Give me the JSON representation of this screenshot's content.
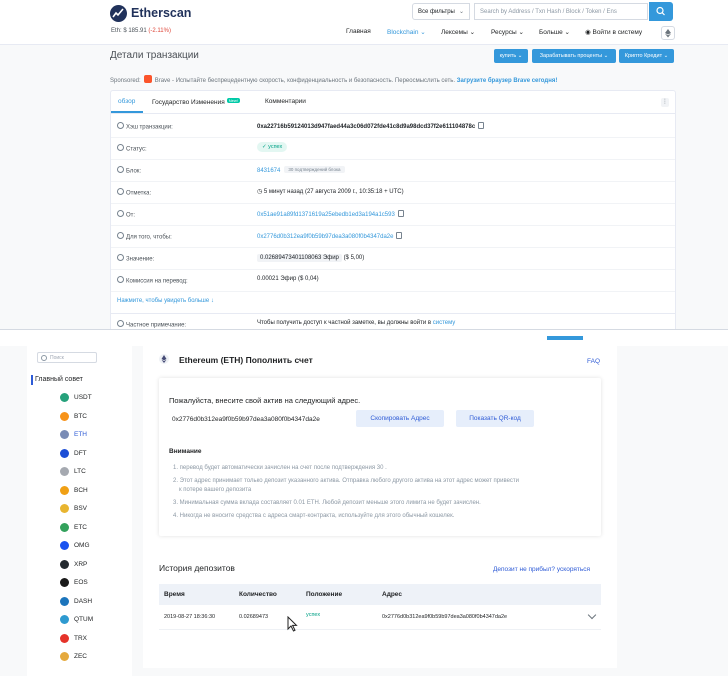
{
  "top": {
    "brand": "Etherscan",
    "price_label": "Eth: $ 185.91",
    "price_change": "(-2.11%)",
    "filter": "Все фильтры",
    "search_placeholder": "Search by Address / Txn Hash / Block / Token / Ens",
    "nav": [
      "Главная",
      "Blockchain",
      "Лексемы",
      "Ресурсы",
      "Больше",
      "Войти в систему"
    ],
    "page_title": "Детали транзакции",
    "buttons": [
      "купить",
      "Зарабатывать проценты",
      "Крипто Кредит"
    ],
    "sponsored_label": "Sponsored:",
    "sponsored_text": "Brave - Испытайте беспрецедентную скорость, конфиденциальность и безопасность. Переосмыслить сеть.",
    "sponsored_link": "Загрузите браузер Brave сегодня!",
    "tabs": [
      "обзор",
      "Государство Изменения",
      "Комментарии"
    ],
    "new_badge": "New!",
    "rows": [
      {
        "label": "Хэш транзакции:",
        "value": "0xa22716b59124013d947faed44a3c06d072fde41c8d9a98dcd37f2e611104878c"
      },
      {
        "label": "Статус:",
        "value": "успех"
      },
      {
        "label": "Блок:",
        "value": "8431674",
        "extra": "30 подтверждений блока"
      },
      {
        "label": "Отметка:",
        "value": "5 минут назад (27 августа 2009 г., 10:35:18 + UTC)"
      },
      {
        "label": "От:",
        "value": "0x51ae91a89fd1371619a25ebedb1ed3a194a1c593"
      },
      {
        "label": "Для того, чтобы:",
        "value": "0x2776d0b312ea9f0b59b97dea3a080f0b4347da2e"
      },
      {
        "label": "Значение:",
        "value": "0.02689473401108063 Эфир",
        "extra": "($ 5,00)"
      },
      {
        "label": "Комиссия на перевод:",
        "value": "0.00021 Эфир ($ 0,04)"
      },
      {
        "label": "Частное примечание:",
        "value": "Чтобы получить доступ к частной заметке, вы должны войти в",
        "link": "систему"
      }
    ],
    "more_link": "Нажмите, чтобы увидеть больше"
  },
  "bottom": {
    "search_placeholder": "Поиск",
    "sidebar_heading": "Главный совет",
    "coins": [
      {
        "name": "USDT",
        "color": "#26a17b"
      },
      {
        "name": "BTC",
        "color": "#f7931a"
      },
      {
        "name": "ETH",
        "color": "#7a8cb5"
      },
      {
        "name": "DFT",
        "color": "#1d4fd6"
      },
      {
        "name": "LTC",
        "color": "#a5a9b0"
      },
      {
        "name": "BCH",
        "color": "#f0a015"
      },
      {
        "name": "BSV",
        "color": "#e8b530"
      },
      {
        "name": "ETC",
        "color": "#33a15c"
      },
      {
        "name": "OMG",
        "color": "#1a53f0"
      },
      {
        "name": "XRP",
        "color": "#23292f"
      },
      {
        "name": "EOS",
        "color": "#1a1a1a"
      },
      {
        "name": "DASH",
        "color": "#1c75bc"
      },
      {
        "name": "QTUM",
        "color": "#2e9ad0"
      },
      {
        "name": "TRX",
        "color": "#e5332a"
      },
      {
        "name": "ZEC",
        "color": "#e5a93d"
      }
    ],
    "deposit_title": "Ethereum (ETH) Пополнить счет",
    "faq": "FAQ",
    "address_prompt": "Пожалуйста, внесите свой актив на следующий адрес.",
    "address": "0x2776d0b312ea9f0b59b97dea3a080f0b4347da2e",
    "copy_button": "Скопировать Адрес",
    "qr_button": "Показать QR-код",
    "attention": "Внимание",
    "notes": [
      "1. перевод будет автоматически зачислен на счет после подтверждения 30 .",
      "2. Этот адрес принимает только депозит указанного актива. Отправка любого другого актива на этот адрес может привести",
      "к потере вашего депозита",
      "3. Минимальная сумма вклада составляет 0.01 ETH. Любой депозит меньше этого лимита не будет зачислен.",
      "4. Никогда не вносите средства с адреса смарт-контракта, используйте для этого обычный кошелек."
    ],
    "history_title": "История депозитов",
    "history_link": "Депозит не прибыл? ускоряться",
    "table_headers": [
      "Время",
      "Количество",
      "Положение",
      "Адрес"
    ],
    "table_row": [
      "2019-08-27 18:36:30",
      "0.02689473",
      "успех",
      "0x2776d0b312ea9f0b59b97dea3a080f0b4347da2e"
    ]
  }
}
